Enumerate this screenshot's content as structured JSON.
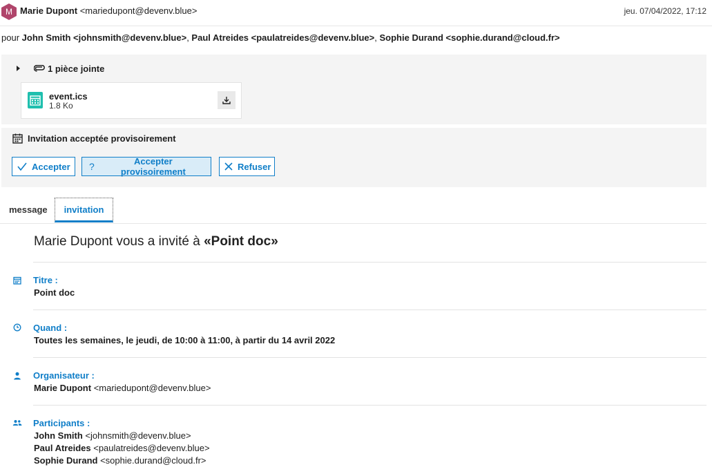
{
  "header": {
    "avatar_letter": "M",
    "sender_name": "Marie Dupont",
    "sender_email": "<mariedupont@devenv.blue>",
    "date": "jeu. 07/04/2022, 17:12"
  },
  "recipients": {
    "prefix": "pour",
    "list": [
      {
        "text": "John Smith <johnsmith@devenv.blue>",
        "sep": ", "
      },
      {
        "text": "Paul Atreides <paulatreides@devenv.blue>",
        "sep": ", "
      },
      {
        "text": "Sophie Durand <sophie.durand@cloud.fr>",
        "sep": ""
      }
    ]
  },
  "attachments": {
    "summary": "1 pièce jointe",
    "file_name": "event.ics",
    "file_size": "1.8 Ko"
  },
  "invitation": {
    "status": "Invitation acceptée provisoirement",
    "accept_label": "Accepter",
    "tentative_label": "Accepter provisoirement",
    "decline_label": "Refuser"
  },
  "tabs": {
    "message": "message",
    "invitation": "invitation"
  },
  "detail": {
    "title_prefix": "Marie Dupont vous a invité à ",
    "title_event": "«Point doc»",
    "title_label": "Titre :",
    "title_value": "Point doc",
    "when_label": "Quand :",
    "when_value": "Toutes les semaines, le jeudi, de 10:00 à 11:00, à partir du 14 avril 2022",
    "organizer_label": "Organisateur :",
    "organizer_name": "Marie Dupont",
    "organizer_email": "<mariedupont@devenv.blue>",
    "participants_label": "Participants :",
    "participants": [
      {
        "name": "John Smith",
        "email": "<johnsmith@devenv.blue>"
      },
      {
        "name": "Paul Atreides",
        "email": "<paulatreides@devenv.blue>"
      },
      {
        "name": "Sophie Durand",
        "email": "<sophie.durand@cloud.fr>"
      }
    ]
  },
  "colors": {
    "accent": "#0f7ec8",
    "avatar": "#b0456b",
    "file_icon": "#1fbfae"
  },
  "icons": {
    "avatar": "hexagon-avatar",
    "expand": "caret-right-icon",
    "attachment": "paperclip-icon",
    "file": "calendar-file-icon",
    "download": "download-icon",
    "status": "calendar-icon",
    "accept": "check-icon",
    "tentative": "question-icon",
    "decline": "close-icon",
    "title": "calendar-icon",
    "when": "clock-icon",
    "organizer": "person-icon",
    "participants": "people-icon"
  }
}
